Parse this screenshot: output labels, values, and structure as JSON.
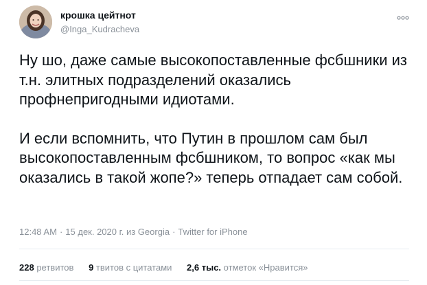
{
  "author": {
    "display_name": "крошка цейтнот",
    "handle": "@Inga_Kudracheva"
  },
  "tweet": {
    "paragraphs": [
      "Ну шо, даже самые высокопоставленные фсбшники из т.н. элитных подразделений оказались профнепригодными идиотами.",
      "И если вспомнить, что Путин в прошлом сам был высокопоставленным фсбшником, то вопрос «как мы оказались в такой жопе?» теперь отпадает сам собой."
    ],
    "time": "12:48 AM",
    "date": "15 дек. 2020 г. из Georgia",
    "source": "Twitter for iPhone",
    "separator": "·"
  },
  "stats": {
    "retweets_count": "228",
    "retweets_label": "ретвитов",
    "quotes_count": "9",
    "quotes_label": "твитов с цитатами",
    "likes_count": "2,6 тыс.",
    "likes_label": "отметок «Нравится»"
  },
  "icons": {
    "more": "more-dots-icon"
  },
  "colors": {
    "text": "#0f1419",
    "secondary": "#8a9199",
    "divider": "#e6ecf0"
  }
}
